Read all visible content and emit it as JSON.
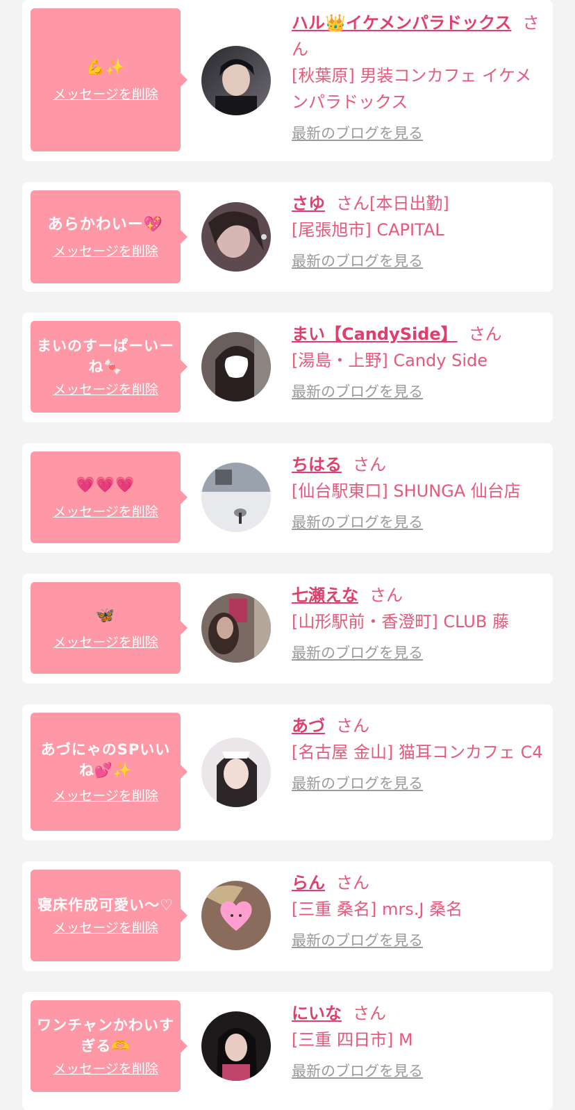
{
  "delete_label": "メッセージを削除",
  "blog_label": "最新のブログを見る",
  "san_label": "さん",
  "colors": {
    "background": "#f3f3f3",
    "card": "#ffffff",
    "bubble": "#ff98a6",
    "name": "#e03f6c",
    "shop": "#e7587a",
    "blog_link": "#9a9a9a"
  },
  "messages": [
    {
      "message": "💪✨",
      "name": "ハル👑イケメンパラドックス",
      "extra": "",
      "shop": "[秋葉原] 男装コンカフェ イケメンパラドックス",
      "avatar_icon": "avatar-photo"
    },
    {
      "message": "あらかわいー💖",
      "name": "さゆ",
      "extra": "[本日出勤]",
      "shop": "[尾張旭市] CAPITAL",
      "avatar_icon": "avatar-photo"
    },
    {
      "message": "まいのすーぱーいーね🍬",
      "name": "まい【CandySide】",
      "extra": "",
      "shop": "[湯島・上野] Candy Side",
      "avatar_icon": "avatar-photo"
    },
    {
      "message": "💗💗💗",
      "name": "ちはる",
      "extra": "",
      "shop": "[仙台駅東口] SHUNGA 仙台店",
      "avatar_icon": "avatar-photo"
    },
    {
      "message": "🦋",
      "name": "七瀬えな",
      "extra": "",
      "shop": "[山形駅前・香澄町] CLUB 藤",
      "avatar_icon": "avatar-photo"
    },
    {
      "message": "あづにゃのSPいいね💕✨",
      "name": "あづ",
      "extra": "",
      "shop": "[名古屋 金山] 猫耳コンカフェ C4",
      "avatar_icon": "avatar-photo"
    },
    {
      "message": "寝床作成可愛い〜♡",
      "name": "らん",
      "extra": "",
      "shop": "[三重 桑名] mrs.J 桑名",
      "avatar_icon": "avatar-photo"
    },
    {
      "message": "ワンチャンかわいすぎる🫶",
      "name": "にいな",
      "extra": "",
      "shop": "[三重 四日市] M",
      "avatar_icon": "avatar-photo"
    }
  ]
}
